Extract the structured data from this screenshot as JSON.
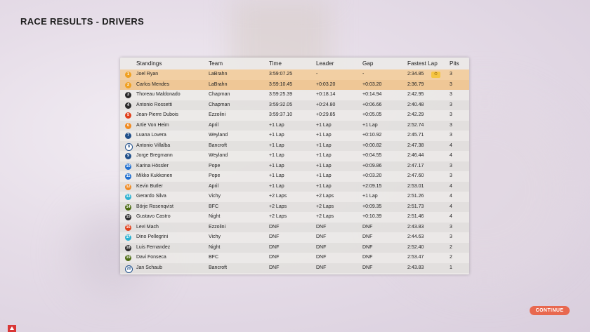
{
  "page_title": "RACE RESULTS - DRIVERS",
  "columns": {
    "standings": "Standings",
    "team": "Team",
    "time": "Time",
    "leader": "Leader",
    "gap": "Gap",
    "fastest_lap": "Fastest Lap",
    "pits": "Pits"
  },
  "rows": [
    {
      "pos": "1",
      "pos_color": "#f0a020",
      "name": "Joel Ryan",
      "team": "LaBrahn",
      "time": "3:59:07.25",
      "leader": "-",
      "gap": "-",
      "fastest_lap": "2:34.85",
      "pits": "3"
    },
    {
      "pos": "2",
      "pos_color": "#f0a020",
      "name": "Carlos Mendes",
      "team": "LaBrahn",
      "time": "3:59:10.45",
      "leader": "+0:03.20",
      "gap": "+0:03.20",
      "fastest_lap": "2:36.79",
      "pits": "3"
    },
    {
      "pos": "3",
      "pos_color": "#2a2a2a",
      "name": "Thoreau Maldonado",
      "team": "Chapman",
      "time": "3:59:25.39",
      "leader": "+0:18.14",
      "gap": "+0:14.94",
      "fastest_lap": "2:42.95",
      "pits": "3"
    },
    {
      "pos": "4",
      "pos_color": "#2a2a2a",
      "name": "Antonio Rossetti",
      "team": "Chapman",
      "time": "3:59:32.05",
      "leader": "+0:24.80",
      "gap": "+0:06.66",
      "fastest_lap": "2:40.48",
      "pits": "3"
    },
    {
      "pos": "5",
      "pos_color": "#e0401a",
      "name": "Jean-Pierre Dubois",
      "team": "Ezzolini",
      "time": "3:59:37.10",
      "leader": "+0:29.85",
      "gap": "+0:05.05",
      "fastest_lap": "2:42.29",
      "pits": "3"
    },
    {
      "pos": "6",
      "pos_color": "#f08a20",
      "name": "Artie Von Heim",
      "team": "April",
      "time": "+1 Lap",
      "leader": "+1 Lap",
      "gap": "+1 Lap",
      "fastest_lap": "2:52.74",
      "pits": "3"
    },
    {
      "pos": "7",
      "pos_color": "#1f4f8a",
      "name": "Luana Lovera",
      "team": "Weyland",
      "time": "+1 Lap",
      "leader": "+1 Lap",
      "gap": "+0:10.92",
      "fastest_lap": "2:45.71",
      "pits": "3"
    },
    {
      "pos": "8",
      "pos_color": "#ffffff",
      "name": "Antonio Villalba",
      "team": "Bancroft",
      "time": "+1 Lap",
      "leader": "+1 Lap",
      "gap": "+0:00.82",
      "fastest_lap": "2:47.38",
      "pits": "4"
    },
    {
      "pos": "9",
      "pos_color": "#1f4f8a",
      "name": "Jorge Bregmann",
      "team": "Weyland",
      "time": "+1 Lap",
      "leader": "+1 Lap",
      "gap": "+0:04.55",
      "fastest_lap": "2:46.44",
      "pits": "4"
    },
    {
      "pos": "10",
      "pos_color": "#1f6fd0",
      "name": "Karina Hössler",
      "team": "Pope",
      "time": "+1 Lap",
      "leader": "+1 Lap",
      "gap": "+0:09.86",
      "fastest_lap": "2:47.17",
      "pits": "3"
    },
    {
      "pos": "11",
      "pos_color": "#1f6fd0",
      "name": "Mikko Kukkonen",
      "team": "Pope",
      "time": "+1 Lap",
      "leader": "+1 Lap",
      "gap": "+0:03.20",
      "fastest_lap": "2:47.60",
      "pits": "3"
    },
    {
      "pos": "12",
      "pos_color": "#f08a20",
      "name": "Kevin Butler",
      "team": "April",
      "time": "+1 Lap",
      "leader": "+1 Lap",
      "gap": "+2:09.15",
      "fastest_lap": "2:53.01",
      "pits": "4"
    },
    {
      "pos": "13",
      "pos_color": "#2ab0d0",
      "name": "Gerardo Silva",
      "team": "Vichy",
      "time": "+2 Laps",
      "leader": "+2 Laps",
      "gap": "+1 Lap",
      "fastest_lap": "2:51.26",
      "pits": "4"
    },
    {
      "pos": "14",
      "pos_color": "#4a6a10",
      "name": "Börje Rosenqvist",
      "team": "BFC",
      "time": "+2 Laps",
      "leader": "+2 Laps",
      "gap": "+0:09.35",
      "fastest_lap": "2:51.73",
      "pits": "4"
    },
    {
      "pos": "15",
      "pos_color": "#2a2a2a",
      "name": "Gustavo Castro",
      "team": "Night",
      "time": "+2 Laps",
      "leader": "+2 Laps",
      "gap": "+0:10.39",
      "fastest_lap": "2:51.46",
      "pits": "4"
    },
    {
      "pos": "16",
      "pos_color": "#e0401a",
      "name": "Levi Mach",
      "team": "Ezzolini",
      "time": "DNF",
      "leader": "DNF",
      "gap": "DNF",
      "fastest_lap": "2:43.83",
      "pits": "3"
    },
    {
      "pos": "17",
      "pos_color": "#2ab0d0",
      "name": "Dino Pellegrini",
      "team": "Vichy",
      "time": "DNF",
      "leader": "DNF",
      "gap": "DNF",
      "fastest_lap": "2:44.63",
      "pits": "3"
    },
    {
      "pos": "18",
      "pos_color": "#2a2a2a",
      "name": "Luis Fernandez",
      "team": "Night",
      "time": "DNF",
      "leader": "DNF",
      "gap": "DNF",
      "fastest_lap": "2:52.40",
      "pits": "2"
    },
    {
      "pos": "19",
      "pos_color": "#4a6a10",
      "name": "Davi Fonseca",
      "team": "BFC",
      "time": "DNF",
      "leader": "DNF",
      "gap": "DNF",
      "fastest_lap": "2:53.47",
      "pits": "2"
    },
    {
      "pos": "20",
      "pos_color": "#ffffff",
      "name": "Jan Schaub",
      "team": "Bancroft",
      "time": "DNF",
      "leader": "DNF",
      "gap": "DNF",
      "fastest_lap": "2:43.83",
      "pits": "1"
    }
  ],
  "fastest_lap_holder_icon": "stopwatch-icon",
  "continue_label": "CONTINUE",
  "colors": {
    "accent": "#e8684f",
    "podium_row": "#f2cfa3"
  }
}
